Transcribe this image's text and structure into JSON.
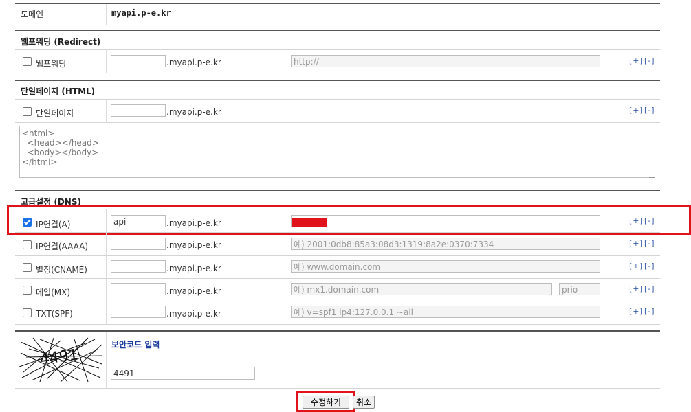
{
  "domain_row": {
    "label": "도메인",
    "value": "myapi.p-e.kr"
  },
  "suffix": ".myapi.p-e.kr",
  "controls": {
    "add": "[+]",
    "remove": "[-]"
  },
  "redirect": {
    "title": "웹포워딩 (Redirect)",
    "checkbox_label": "웹포워딩",
    "host_value": "",
    "url_placeholder": "http://"
  },
  "single_page": {
    "title": "단일페이지 (HTML)",
    "checkbox_label": "단일페이지",
    "host_value": "",
    "html_content": "<html>\n  <head></head>\n  <body></body>\n</html>"
  },
  "dns": {
    "title": "고급설정 (DNS)",
    "records": [
      {
        "label": "IP연결(A)",
        "checked": true,
        "host_value": "api",
        "value_placeholder": ""
      },
      {
        "label": "IP연결(AAAA)",
        "checked": false,
        "host_value": "",
        "value_placeholder": "예) 2001:0db8:85a3:08d3:1319:8a2e:0370:7334"
      },
      {
        "label": "별칭(CNAME)",
        "checked": false,
        "host_value": "",
        "value_placeholder": "예) www.domain.com"
      },
      {
        "label": "메일(MX)",
        "checked": false,
        "host_value": "",
        "value_placeholder": "예) mx1.domain.com",
        "prio_placeholder": "prio"
      },
      {
        "label": "TXT(SPF)",
        "checked": false,
        "host_value": "",
        "value_placeholder": "예) v=spf1 ip4:127.0.0.1 ~all"
      }
    ]
  },
  "captcha": {
    "image_code": "4491",
    "title": "보안코드 입력",
    "input_value": "4491"
  },
  "buttons": {
    "submit": "수정하기",
    "cancel": "취소"
  },
  "colors": {
    "highlight": "#e0121b",
    "checkbox_checked": "#1a73e8",
    "captcha_title": "#1a3a9c"
  }
}
